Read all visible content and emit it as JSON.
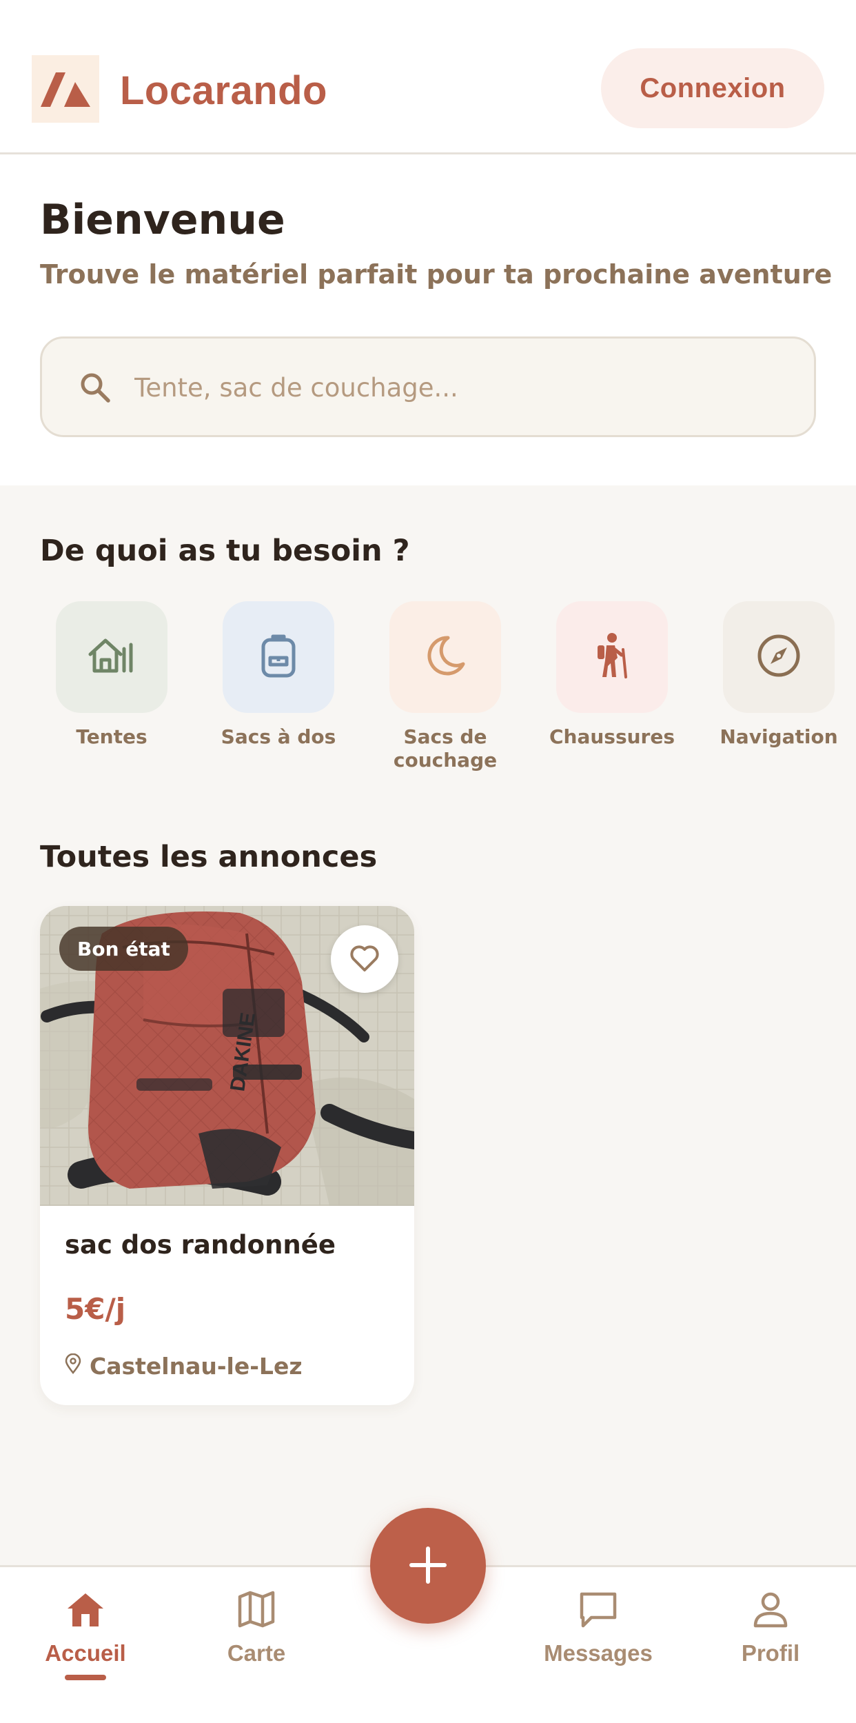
{
  "header": {
    "app_name": "Locarando",
    "login_label": "Connexion"
  },
  "welcome": {
    "title": "Bienvenue",
    "subtitle": "Trouve le matériel parfait pour ta prochaine aventure"
  },
  "search": {
    "placeholder": "Tente, sac de couchage..."
  },
  "categories": {
    "title": "De quoi as tu besoin ?",
    "items": [
      {
        "label": "Tentes",
        "icon": "tent-icon",
        "bg": "#eaede6",
        "color": "#6f8566"
      },
      {
        "label": "Sacs à dos",
        "icon": "backpack-icon",
        "bg": "#e7edf5",
        "color": "#6d8aa8"
      },
      {
        "label": "Sacs de couchage",
        "icon": "moon-icon",
        "bg": "#fbeee6",
        "color": "#d59a6c"
      },
      {
        "label": "Chaussures",
        "icon": "hiker-icon",
        "bg": "#fbecea",
        "color": "#b95e48"
      },
      {
        "label": "Navigation",
        "icon": "compass-icon",
        "bg": "#f2eee8",
        "color": "#8a6e52"
      }
    ]
  },
  "listings": {
    "title": "Toutes les annonces",
    "items": [
      {
        "badge": "Bon état",
        "title": "sac dos randonnée",
        "price": "5€/j",
        "location": "Castelnau-le-Lez"
      }
    ]
  },
  "nav": {
    "items": [
      {
        "label": "Accueil",
        "icon": "home-icon",
        "active": true
      },
      {
        "label": "Carte",
        "icon": "map-icon",
        "active": false
      },
      {
        "label": "Messages",
        "icon": "chat-icon",
        "active": false
      },
      {
        "label": "Profil",
        "icon": "user-icon",
        "active": false
      }
    ],
    "fab_icon": "plus-icon"
  },
  "colors": {
    "accent": "#b95e48",
    "muted_text": "#8c7259",
    "background": "#f8f6f3"
  }
}
